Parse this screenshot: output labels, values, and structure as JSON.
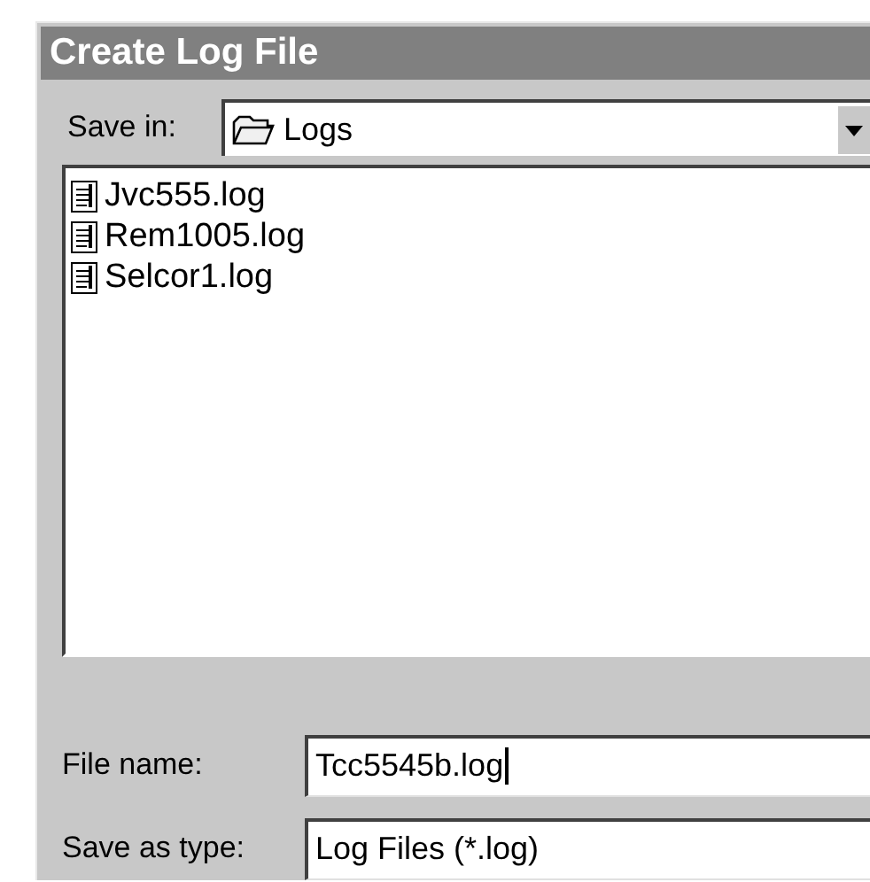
{
  "window": {
    "title": "Create Log File"
  },
  "save_in": {
    "label": "Save in:",
    "value": "Logs"
  },
  "files": [
    {
      "name": "Jvc555.log"
    },
    {
      "name": "Rem1005.log"
    },
    {
      "name": "Selcor1.log"
    }
  ],
  "file_name": {
    "label": "File name:",
    "value": "Tcc5545b.log",
    "focused": true
  },
  "save_as_type": {
    "label": "Save as type:",
    "value": "Log Files (*.log)"
  }
}
